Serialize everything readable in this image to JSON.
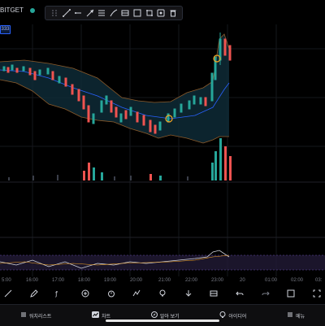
{
  "header": {
    "symbol": "BITGET",
    "price_tag": "333"
  },
  "draw_toolbar": {
    "tools": [
      "crosshair-tool-icon",
      "trend-line-tool-icon",
      "ray-tool-icon",
      "arrow-tool-icon",
      "fib-tool-icon",
      "brush-tool-icon",
      "pattern-tool-icon",
      "rectangle-tool-icon",
      "range-tool-icon",
      "emoji-tool-icon",
      "trash-tool-icon"
    ]
  },
  "time_axis": {
    "labels": [
      "5:00",
      "16:00",
      "17:00",
      "18:00",
      "19:00",
      "20:00",
      "21:00",
      "22:00",
      "23:00",
      "20",
      "01:00",
      "02:00",
      "03:"
    ]
  },
  "bottom_toolbar": {
    "tools": [
      "trend-line-icon",
      "pen-icon",
      "fx-indicator-icon",
      "add-icon",
      "alarm-icon",
      "compare-icon",
      "lightbulb-icon",
      "download-icon",
      "table-icon",
      "undo-icon",
      "redo-icon",
      "settings-icon",
      "fullscreen-icon"
    ]
  },
  "bottom_nav": {
    "items": [
      {
        "label": "워치리스트",
        "icon": "watchlist-icon"
      },
      {
        "label": "차트",
        "icon": "chart-icon"
      },
      {
        "label": "알아 보기",
        "icon": "explore-icon"
      },
      {
        "label": "아이디어",
        "icon": "ideas-icon"
      },
      {
        "label": "메뉴",
        "icon": "menu-icon"
      }
    ]
  },
  "colors": {
    "up": "#26a69a",
    "down": "#ef5350",
    "band": "#1a3a4a",
    "accent": "#2962ff",
    "highlight": "#f5a623"
  }
}
